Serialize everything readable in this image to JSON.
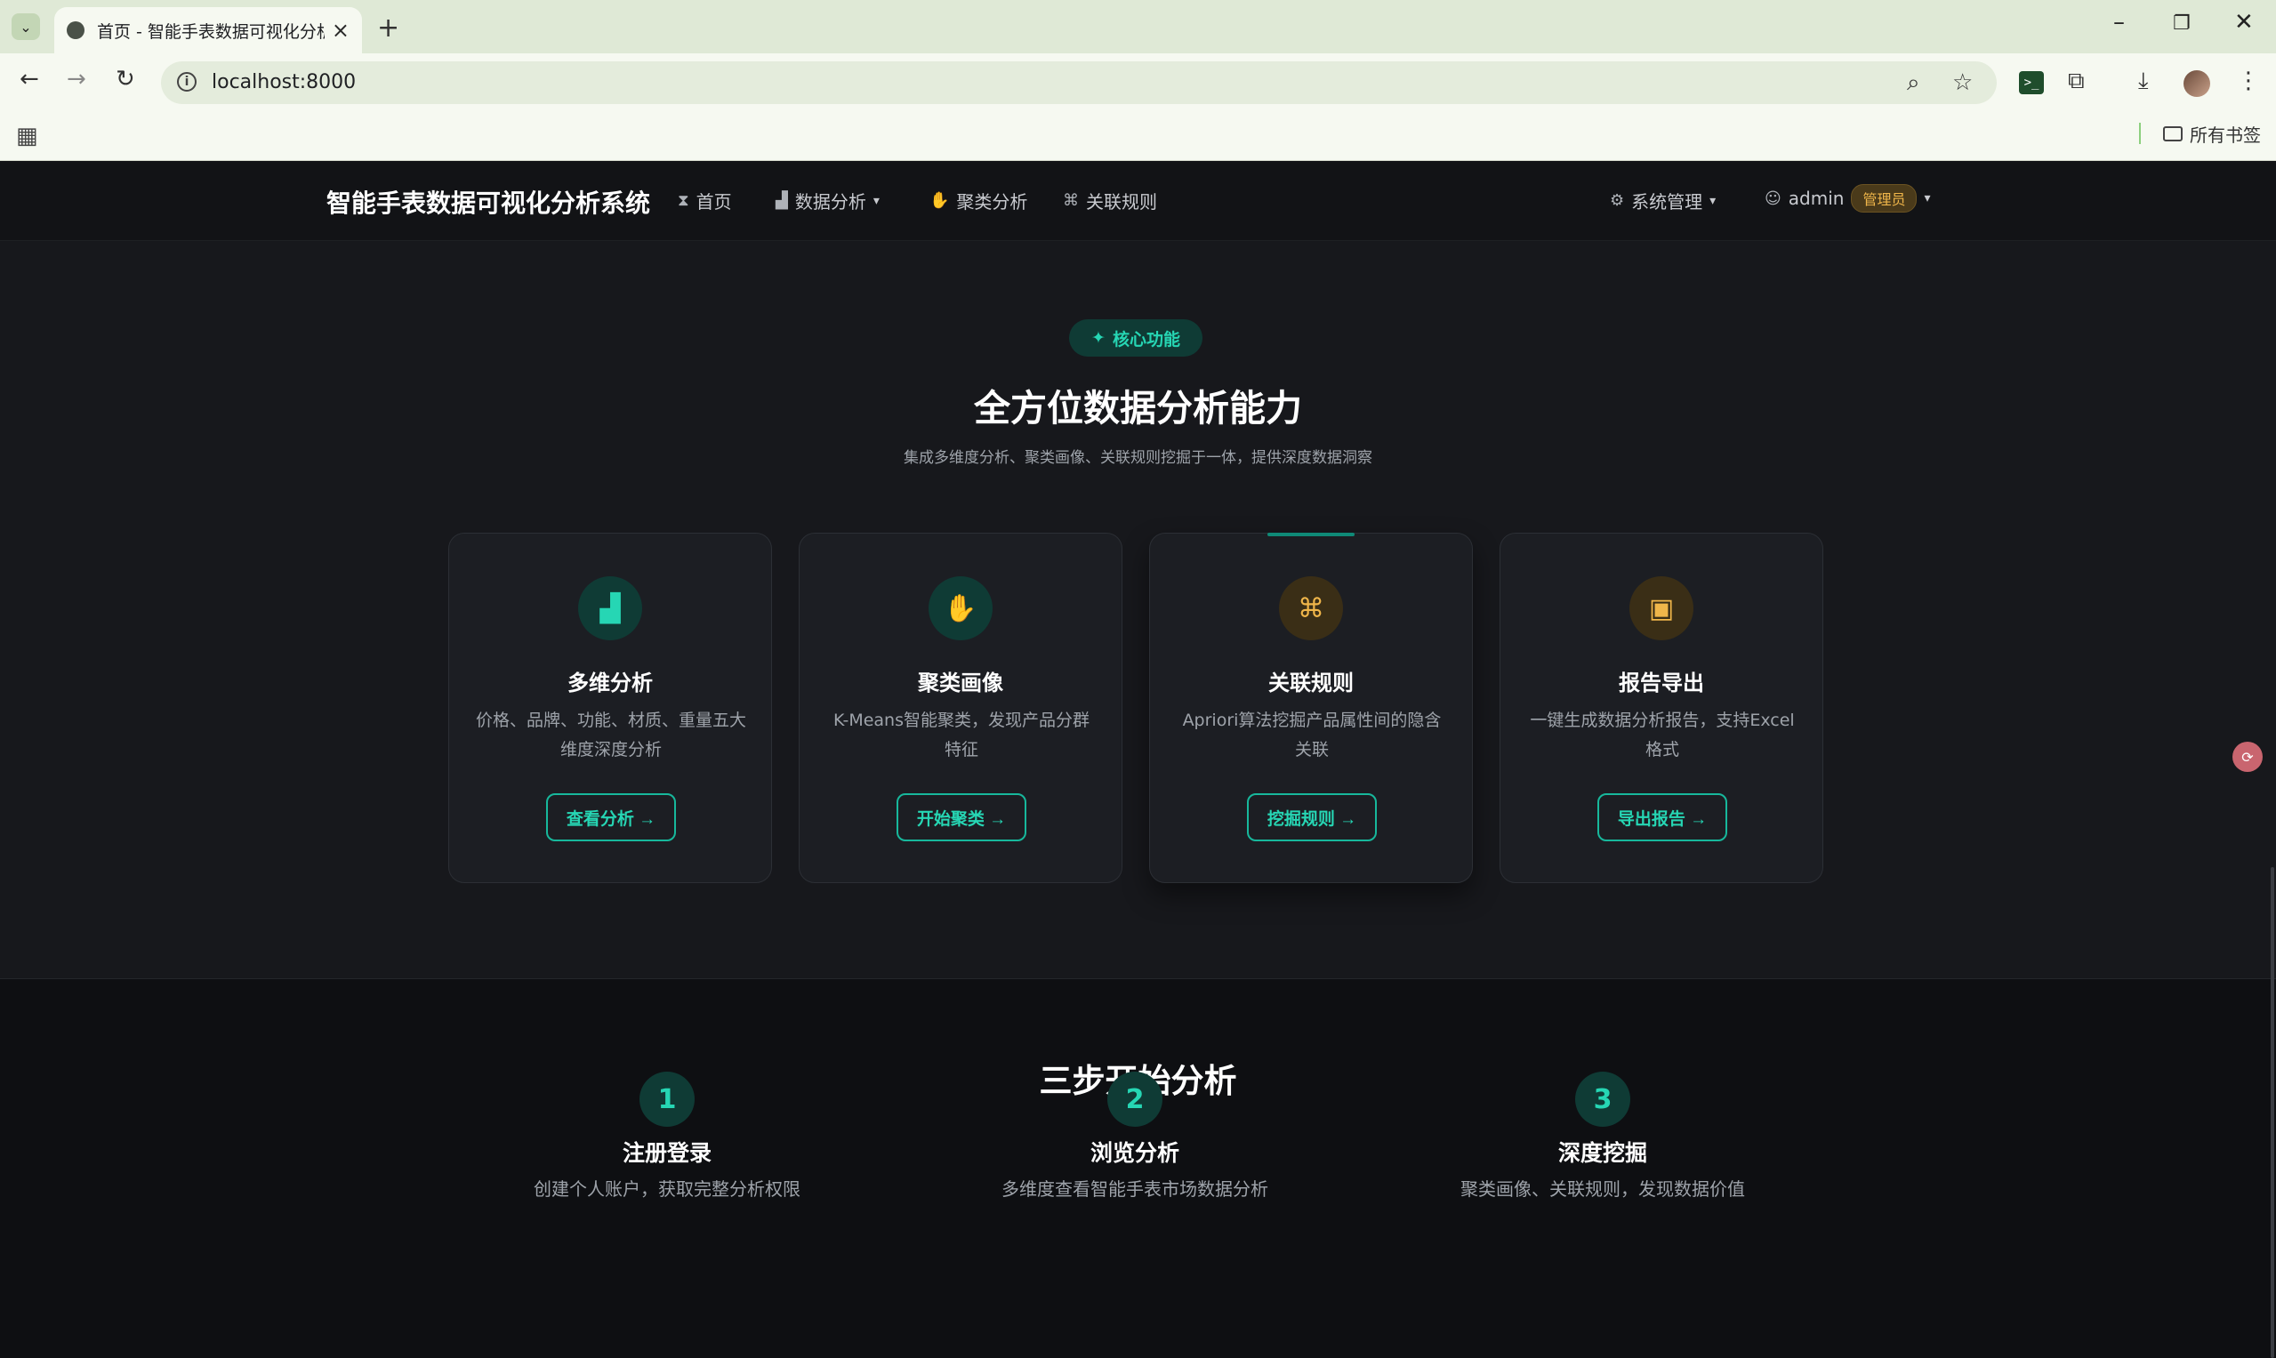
{
  "browser": {
    "tab_title": "首页 - 智能手表数据可视化分析",
    "url": "localhost:8000",
    "bookmarks_folder": "所有书签"
  },
  "navbar": {
    "brand": "智能手表数据可视化分析系统",
    "items": [
      {
        "label": "首页",
        "icon": "hourglass-icon"
      },
      {
        "label": "数据分析",
        "icon": "bar-chart-icon"
      },
      {
        "label": "聚类分析",
        "icon": "thumbs-down-icon"
      },
      {
        "label": "关联规则",
        "icon": "gamepad-icon"
      }
    ],
    "system_menu": "系统管理",
    "user": "admin",
    "role": "管理员"
  },
  "features": {
    "pill": "核心功能",
    "title": "全方位数据分析能力",
    "subtitle": "集成多维度分析、聚类画像、关联规则挖掘于一体，提供深度数据洞察",
    "cards": [
      {
        "title": "多维分析",
        "desc": "价格、品牌、功能、材质、重量五大维度深度分析",
        "button": "查看分析 →",
        "icon": "bar-chart-icon",
        "color": "#26d6b4"
      },
      {
        "title": "聚类画像",
        "desc": "K-Means智能聚类，发现产品分群特征",
        "button": "开始聚类 →",
        "icon": "thumbs-down-icon",
        "color": "#26d6b4"
      },
      {
        "title": "关联规则",
        "desc": "Apriori算法挖掘产品属性间的隐含关联",
        "button": "挖掘规则 →",
        "icon": "gamepad-icon",
        "color": "#f0b64a"
      },
      {
        "title": "报告导出",
        "desc": "一键生成数据分析报告，支持Excel格式",
        "button": "导出报告 →",
        "icon": "document-icon",
        "color": "#f0b64a"
      }
    ]
  },
  "steps": {
    "title": "三步开始分析",
    "items": [
      {
        "num": "1",
        "title": "注册登录",
        "desc": "创建个人账户，获取完整分析权限"
      },
      {
        "num": "2",
        "title": "浏览分析",
        "desc": "多维度查看智能手表市场数据分析"
      },
      {
        "num": "3",
        "title": "深度挖掘",
        "desc": "聚类画像、关联规则，发现数据价值"
      }
    ]
  }
}
